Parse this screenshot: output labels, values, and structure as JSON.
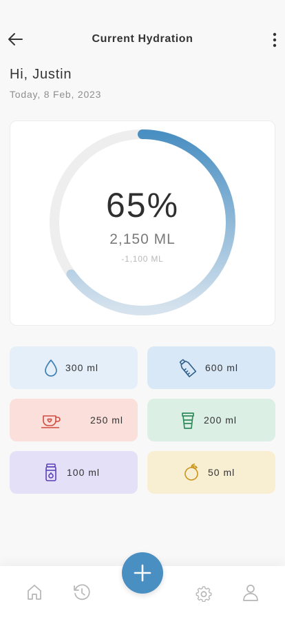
{
  "header": {
    "title": "Current Hydration"
  },
  "greeting": "Hi, Justin",
  "date": "Today, 8 Feb, 2023",
  "progress": {
    "percent_label": "65%",
    "percent": 65,
    "amount_label": "2,150 ML",
    "remaining_label": "-1,100 ML"
  },
  "drinks": [
    {
      "icon": "water-drop-icon",
      "label": "300 ml"
    },
    {
      "icon": "bottle-icon",
      "label": "600 ml"
    },
    {
      "icon": "coffee-cup-icon",
      "label": "250 ml"
    },
    {
      "icon": "takeaway-cup-icon",
      "label": "200 ml"
    },
    {
      "icon": "jar-icon",
      "label": "100 ml"
    },
    {
      "icon": "fruit-icon",
      "label": "50 ml"
    }
  ],
  "nav": {
    "items": [
      "home-icon",
      "history-icon",
      "add-icon",
      "settings-icon",
      "profile-icon"
    ]
  },
  "colors": {
    "accent": "#4a8fc2",
    "ring_track": "#eeeeee",
    "ring_fade": "#d6e3ee"
  }
}
